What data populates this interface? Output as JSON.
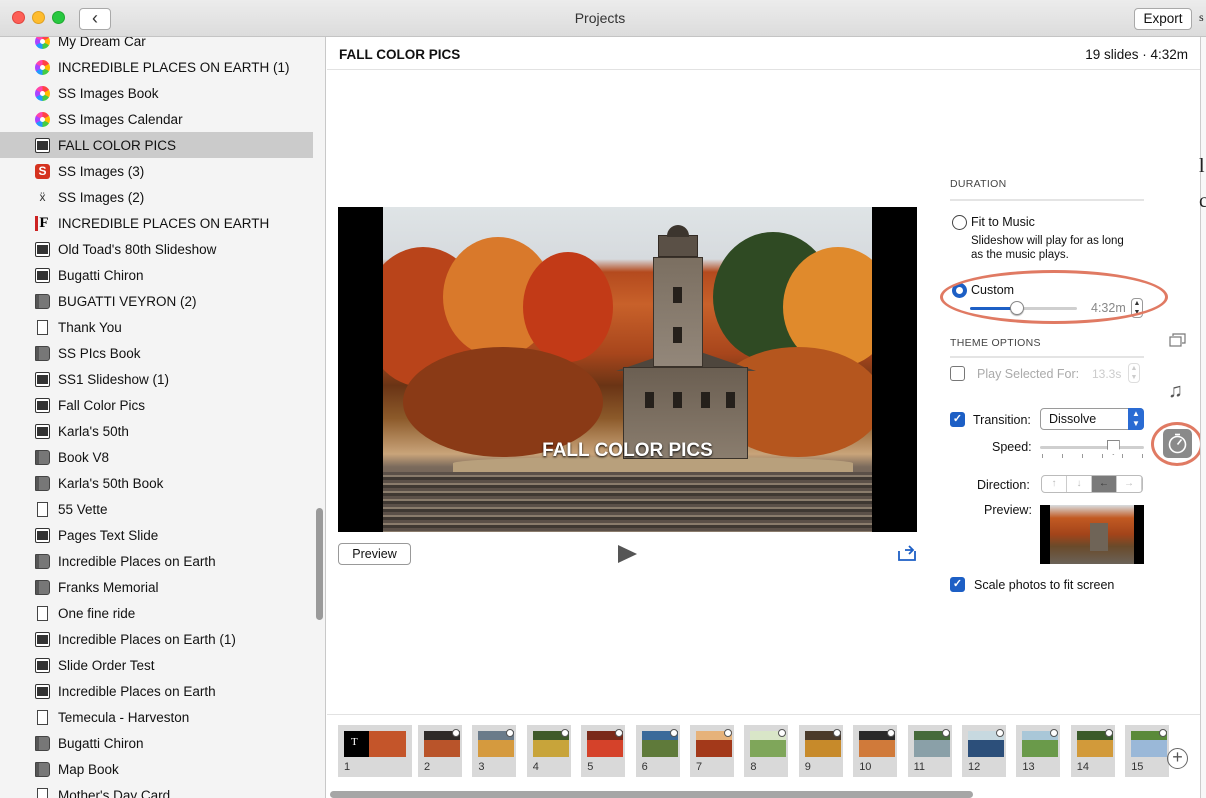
{
  "window": {
    "title": "Projects",
    "export_label": "Export",
    "back_glyph": "‹"
  },
  "sidebar": {
    "selected_index": 4,
    "items": [
      {
        "label": "My Dream Car",
        "icon": "photos-icon"
      },
      {
        "label": "INCREDIBLE PLACES ON EARTH (1)",
        "icon": "photos-icon"
      },
      {
        "label": "SS Images  Book",
        "icon": "photos-icon"
      },
      {
        "label": "SS Images Calendar",
        "icon": "photos-icon"
      },
      {
        "label": "FALL COLOR PICS",
        "icon": "slideshow-icon"
      },
      {
        "label": "SS Images (3)",
        "icon": "s-app-icon"
      },
      {
        "label": "SS Images (2)",
        "icon": "x-app-icon"
      },
      {
        "label": "INCREDIBLE PLACES ON EARTH",
        "icon": "f-app-icon"
      },
      {
        "label": "Old Toad's 80th Slideshow",
        "icon": "slideshow-icon"
      },
      {
        "label": "Bugatti Chiron",
        "icon": "slideshow-icon"
      },
      {
        "label": "BUGATTI VEYRON (2)",
        "icon": "book-icon"
      },
      {
        "label": "Thank You",
        "icon": "card-icon"
      },
      {
        "label": "SS PIcs Book",
        "icon": "book-icon"
      },
      {
        "label": "SS1 Slideshow (1)",
        "icon": "slideshow-icon"
      },
      {
        "label": "Fall Color Pics",
        "icon": "slideshow-icon"
      },
      {
        "label": "Karla's 50th",
        "icon": "slideshow-icon"
      },
      {
        "label": "Book V8",
        "icon": "book-icon"
      },
      {
        "label": "Karla's 50th Book",
        "icon": "book-icon"
      },
      {
        "label": "55 Vette",
        "icon": "card-icon"
      },
      {
        "label": "Pages Text Slide",
        "icon": "slideshow-icon"
      },
      {
        "label": "Incredible Places on Earth",
        "icon": "book-icon"
      },
      {
        "label": "Franks Memorial",
        "icon": "book-icon"
      },
      {
        "label": "One fine ride",
        "icon": "card-icon"
      },
      {
        "label": "Incredible Places on Earth (1)",
        "icon": "slideshow-icon"
      },
      {
        "label": "Slide Order Test",
        "icon": "slideshow-icon"
      },
      {
        "label": "Incredible Places on Earth",
        "icon": "slideshow-icon"
      },
      {
        "label": "Temecula - Harveston",
        "icon": "card-icon"
      },
      {
        "label": "Bugatti Chiron",
        "icon": "book-icon"
      },
      {
        "label": "Map Book",
        "icon": "book-icon"
      },
      {
        "label": "Mother's Day Card",
        "icon": "card-icon"
      }
    ]
  },
  "header": {
    "project_name": "FALL COLOR PICS",
    "meta": "19 slides · 4:32m"
  },
  "viewer": {
    "slide_title": "FALL COLOR PICS",
    "preview_label": "Preview"
  },
  "panel": {
    "duration_header": "DURATION",
    "fit_label": "Fit to Music",
    "fit_desc_1": "Slideshow will play for as long",
    "fit_desc_2": "as the music plays.",
    "custom_label": "Custom",
    "custom_value": "4:32m",
    "custom_slider_fraction": 0.44,
    "theme_header": "THEME OPTIONS",
    "play_selected_label": "Play Selected For:",
    "play_selected_value": "13.3s",
    "transition_label": "Transition:",
    "transition_value": "Dissolve",
    "speed_label": "Speed:",
    "speed_fraction": 0.7,
    "direction_label": "Direction:",
    "directions": [
      "↑",
      "↓",
      "←",
      "→"
    ],
    "direction_selected": 2,
    "preview_label": "Preview:",
    "scale_label": "Scale photos to fit screen"
  },
  "filmstrip": {
    "thumbs": [
      {
        "num": "1"
      },
      {
        "num": "2"
      },
      {
        "num": "3"
      },
      {
        "num": "4"
      },
      {
        "num": "5"
      },
      {
        "num": "6"
      },
      {
        "num": "7"
      },
      {
        "num": "8"
      },
      {
        "num": "9"
      },
      {
        "num": "10"
      },
      {
        "num": "11"
      },
      {
        "num": "12"
      },
      {
        "num": "13"
      },
      {
        "num": "14"
      },
      {
        "num": "15"
      }
    ]
  },
  "colors": {
    "accent": "#1d5fc5",
    "highlight_oval": "#e07a63",
    "selected_row": "#cbcbcb"
  }
}
